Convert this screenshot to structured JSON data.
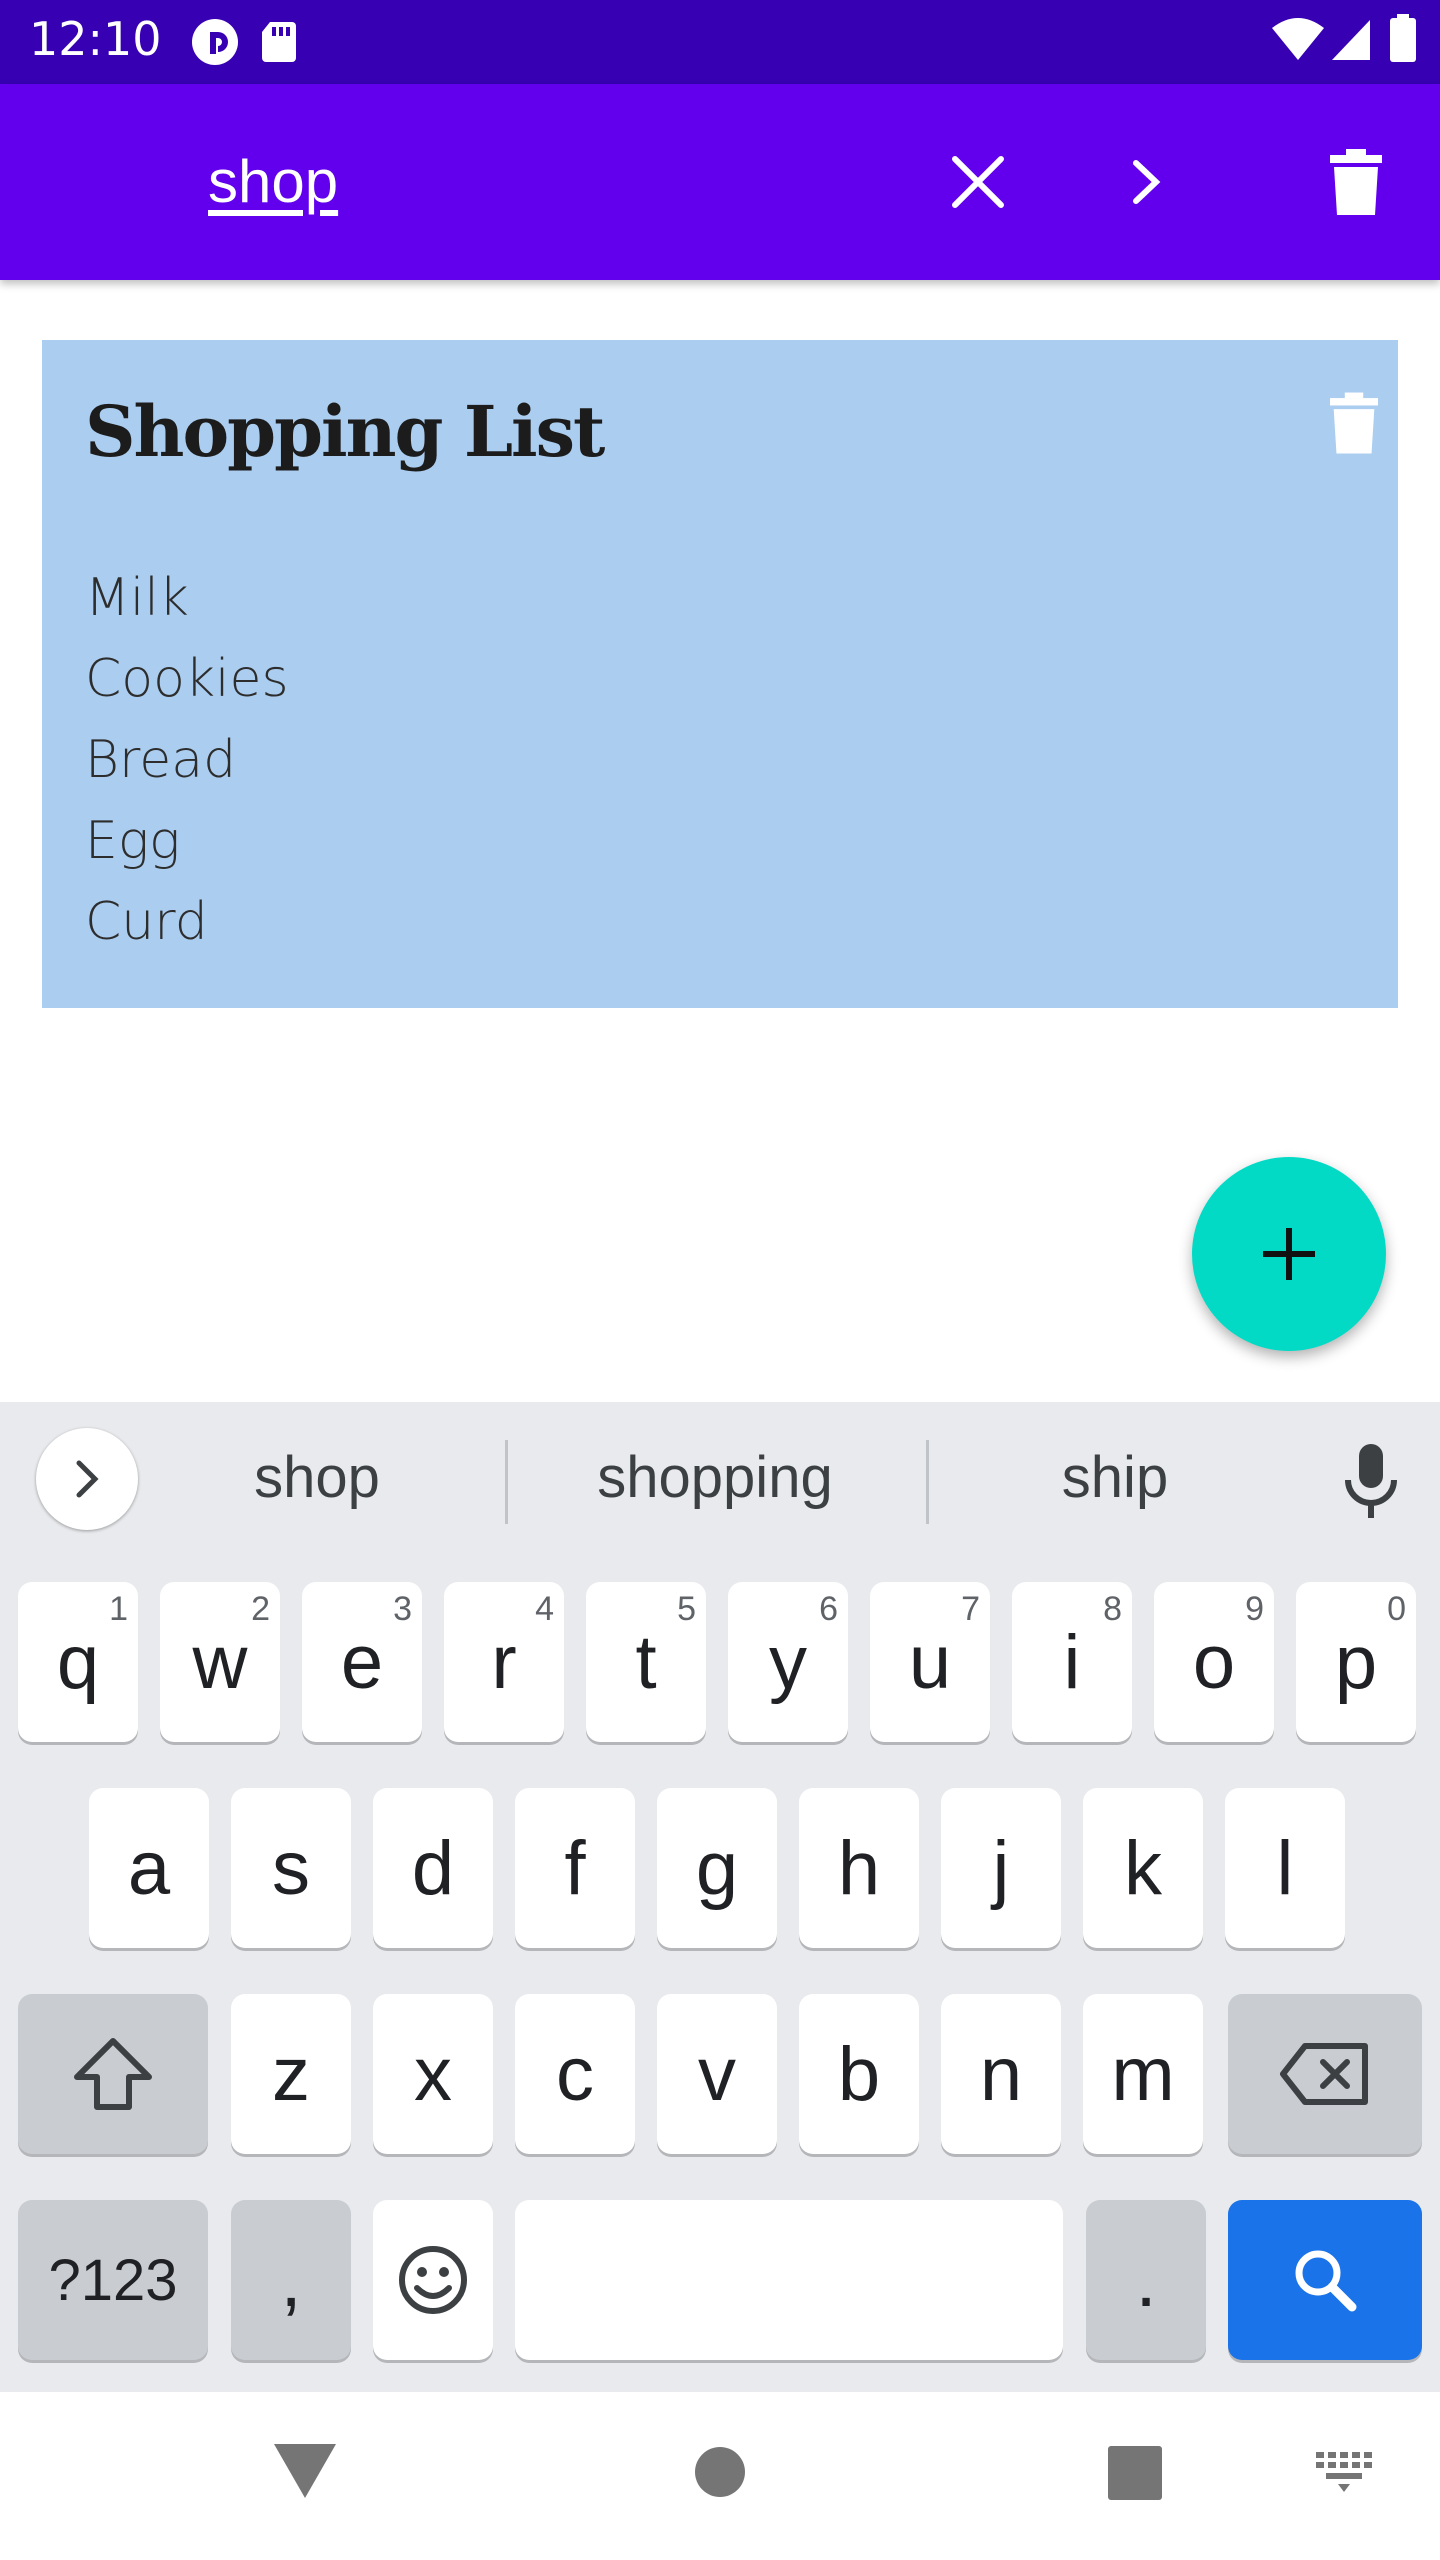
{
  "status_bar": {
    "time": "12:10",
    "left_icons": [
      "pocket-casts-icon",
      "sd-card-icon"
    ],
    "right_icons": [
      "wifi-icon",
      "cell-signal-icon",
      "battery-icon"
    ]
  },
  "app_bar": {
    "search_value": "shop",
    "icons": [
      "close-icon",
      "chevron-right-icon",
      "delete-icon"
    ]
  },
  "note": {
    "title": "Shopping List",
    "items": [
      "Milk",
      "Cookies",
      "Bread",
      "Egg",
      "Curd"
    ],
    "background": "#abcdef"
  },
  "fab": {
    "icon": "add-icon",
    "color": "#03dac5"
  },
  "keyboard": {
    "suggestions": [
      "shop",
      "shopping",
      "ship"
    ],
    "row1": [
      {
        "k": "q",
        "h": "1"
      },
      {
        "k": "w",
        "h": "2"
      },
      {
        "k": "e",
        "h": "3"
      },
      {
        "k": "r",
        "h": "4"
      },
      {
        "k": "t",
        "h": "5"
      },
      {
        "k": "y",
        "h": "6"
      },
      {
        "k": "u",
        "h": "7"
      },
      {
        "k": "i",
        "h": "8"
      },
      {
        "k": "o",
        "h": "9"
      },
      {
        "k": "p",
        "h": "0"
      }
    ],
    "row2": [
      "a",
      "s",
      "d",
      "f",
      "g",
      "h",
      "j",
      "k",
      "l"
    ],
    "row3": [
      "z",
      "x",
      "c",
      "v",
      "b",
      "n",
      "m"
    ],
    "symbols_label": "?123",
    "comma_label": ",",
    "period_label": "."
  },
  "colors": {
    "status_bar": "#3700b3",
    "app_bar": "#6200ee",
    "accent_key": "#1a73e8"
  }
}
